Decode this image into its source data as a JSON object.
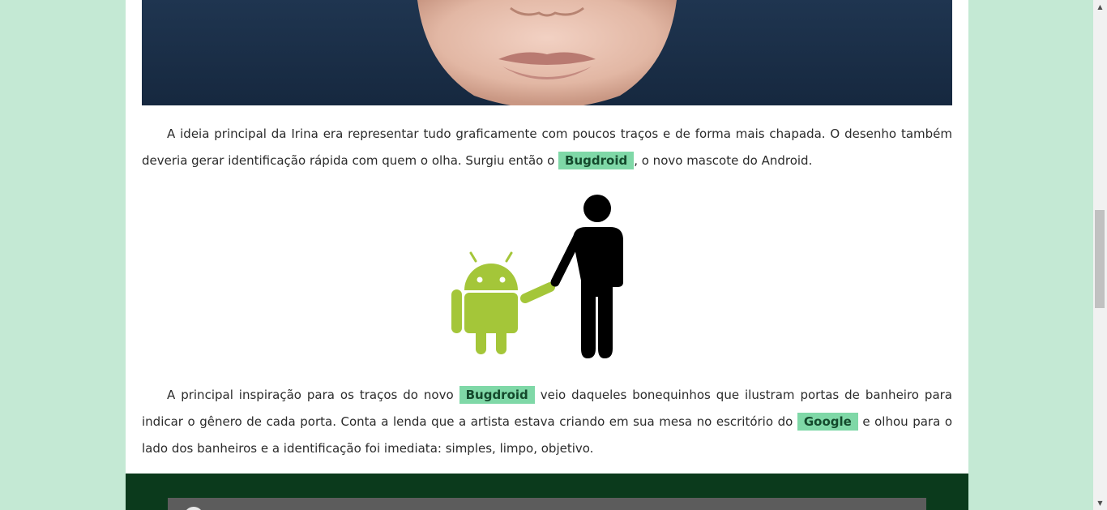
{
  "article": {
    "paragraph1": {
      "before": "A ideia principal da Irina era representar tudo graficamente com poucos traços e de forma mais chapada. O desenho também deveria gerar identificação rápida com quem o olha. Surgiu então o ",
      "tag": "Bugdroid",
      "after": ", o novo mascote do Android."
    },
    "paragraph2": {
      "before": "A principal inspiração para os traços do novo ",
      "tag1": "Bugdroid",
      "middle": " veio daqueles bonequinhos que ilustram portas de banheiro para indicar o gênero de cada porta. Conta a lenda que a artista estava criando em sua mesa no escritório do ",
      "tag2": "Google",
      "after": " e olhou para o lado dos banheiros e a identificação foi imediata: simples, limpo, objetivo."
    }
  },
  "colors": {
    "page_background": "#c4e9d4",
    "tag_background": "#7fd8a7",
    "android_green": "#a4c639",
    "footer_band": "#0b3a1c"
  },
  "icons": {
    "scroll_up": "▲",
    "scroll_down": "▼"
  }
}
